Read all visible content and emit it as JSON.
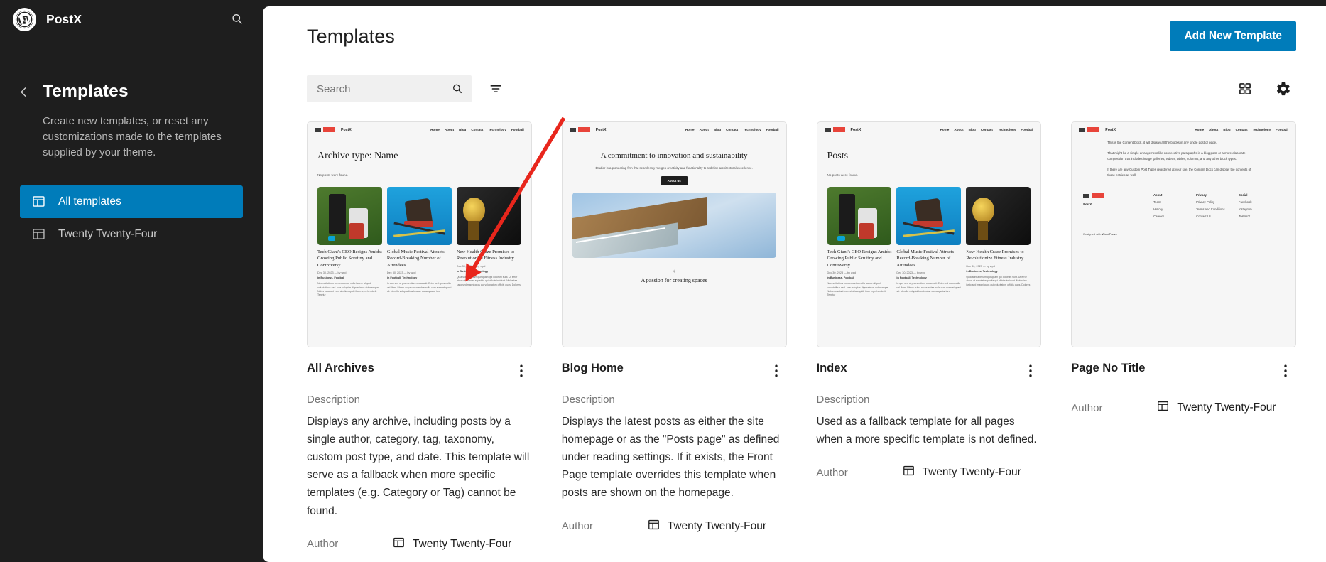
{
  "sidebar": {
    "site_name": "PostX",
    "search_icon": "search-icon",
    "back_icon": "chevron-left-icon",
    "title": "Templates",
    "description": "Create new templates, or reset any customizations made to the templates supplied by your theme.",
    "items": [
      {
        "label": "All templates",
        "icon": "template-icon",
        "active": true
      },
      {
        "label": "Twenty Twenty-Four",
        "icon": "template-icon",
        "active": false
      }
    ]
  },
  "header": {
    "title": "Templates",
    "add_button": "Add New Template"
  },
  "toolbar": {
    "search_placeholder": "Search",
    "search_value": "",
    "search_icon": "search-icon",
    "filter_icon": "filter-icon",
    "grid_view_icon": "grid-view-icon",
    "settings_icon": "gear-icon"
  },
  "colors": {
    "accent": "#007cba",
    "sidebar_bg": "#1e1e1e",
    "annotation": "#e8261c"
  },
  "labels": {
    "description": "Description",
    "author": "Author"
  },
  "preview": {
    "brand": "PostX",
    "menu": [
      "Home",
      "About",
      "Blog",
      "Contact",
      "Technology",
      "Football"
    ],
    "no_posts": "No posts were found.",
    "posts": [
      {
        "title": "Tech Giant's CEO Resigns Amidst Growing Public Scrutiny and Controversy",
        "meta": "Dec 30, 2023 — by wpd",
        "cats": "in Business, Football",
        "body": "Necessitatibus consequuntur nulla facere aliquid voluptatibus sed. Iure voluptas dignissimos doloremque. Nobis nesciunt eum similia cupidit illum reprehenderit. Tenetur"
      },
      {
        "title": "Global Music Festival Attracts Record-Breaking Number of Attendees",
        "meta": "Dec 30, 2023 — by wpd",
        "cats": "in Football, Technology",
        "body": "In quo sed ut praesentium occaecati. Enim sed quos nulla vel illum. Libero culpa recusandae nulla cum eveniet quasi sit. Id nulla voluptatibus beatae consequatur iure"
      },
      {
        "title": "New Health Craze Promises to Revolutionize Fitness Industry",
        "meta": "Dec 30, 2023 — by wpd",
        "cats": "in Business, Technology",
        "body": "Quia sunt aperiam quisquam qui dolorum sunt. Ut error atque ut eveniet expedita qui officiis incidunt. Molestiae iusto sed magni quos qui voluptatum officiis quos. Dolores"
      }
    ],
    "blog_home": {
      "hero_title": "A commitment to innovation and sustainability",
      "hero_sub": "Étudier is a pioneering firm that seamlessly merges creativity and functionality to redefine architectural excellence.",
      "hero_button": "About us",
      "dot": "✳",
      "tail": "A passion for creating spaces"
    },
    "page_no_title": {
      "paragraphs": [
        "This is the Content block, it will display all the blocks in any single post or page.",
        "That might be a simple arrangement like consecutive paragraphs in a blog post, or a more elaborate composition that includes image galleries, videos, tables, columns, and any other block types.",
        "If there are any Custom Post Types registered at your site, the Content block can display the contents of those entries as well."
      ],
      "footer_cols": [
        {
          "heading": "About",
          "links": [
            "Team",
            "History",
            "Careers"
          ]
        },
        {
          "heading": "Privacy",
          "links": [
            "Privacy Policy",
            "Terms and Conditions",
            "Contact Us"
          ]
        },
        {
          "heading": "Social",
          "links": [
            "Facebook",
            "Instagram",
            "Twitter/X"
          ]
        }
      ],
      "credit_prefix": "Designed with ",
      "credit_brand": "WordPress"
    }
  },
  "cards": [
    {
      "title": "All Archives",
      "preview_heading": "Archive type: Name",
      "has_description": true,
      "description": "Displays any archive, including posts by a single author, category, tag, taxonomy, custom post type, and date. This template will serve as a fallback when more specific templates (e.g. Category or Tag) cannot be found.",
      "author": "Twenty Twenty-Four",
      "kebab_icon": "more-options-icon"
    },
    {
      "title": "Blog Home",
      "preview_heading": "",
      "has_description": true,
      "description": "Displays the latest posts as either the site homepage or as the \"Posts page\" as defined under reading settings. If it exists, the Front Page template overrides this template when posts are shown on the homepage.",
      "author": "Twenty Twenty-Four",
      "kebab_icon": "more-options-icon"
    },
    {
      "title": "Index",
      "preview_heading": "Posts",
      "has_description": true,
      "description": "Used as a fallback template for all pages when a more specific template is not defined.",
      "author": "Twenty Twenty-Four",
      "kebab_icon": "more-options-icon"
    },
    {
      "title": "Page No Title",
      "preview_heading": "",
      "has_description": false,
      "description": "",
      "author": "Twenty Twenty-Four",
      "kebab_icon": "more-options-icon"
    }
  ]
}
